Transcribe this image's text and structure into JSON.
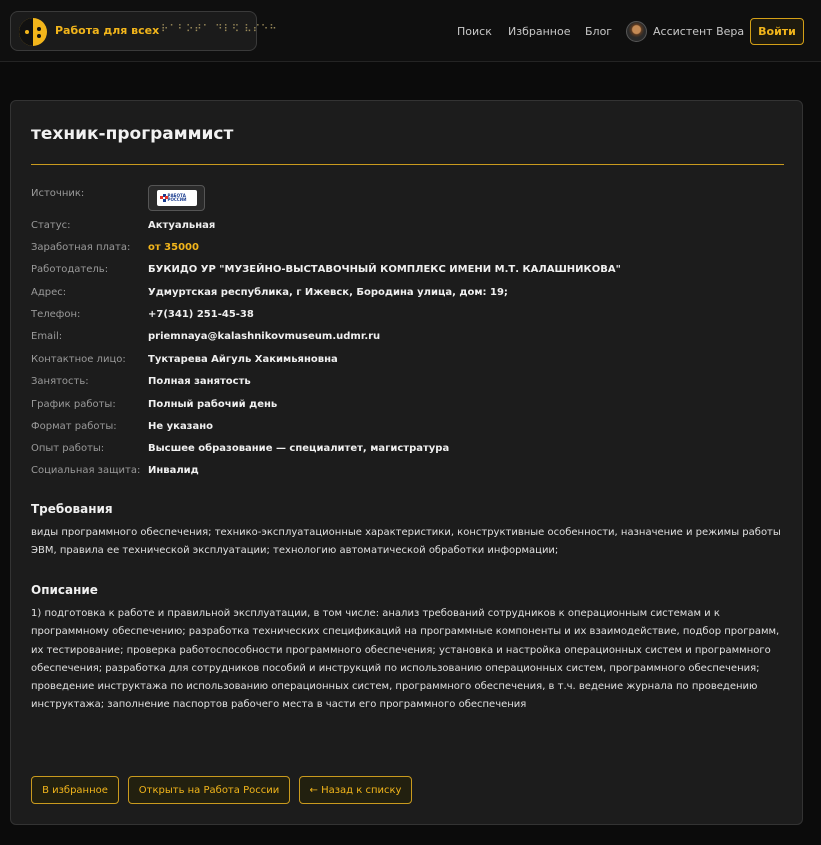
{
  "header": {
    "logo_title": "Работа для всех",
    "logo_braille": "⠗⠁⠃⠕⠞⠁ ⠙⠇⠫ ⠧⠎⠑⠓",
    "nav": {
      "search": "Поиск",
      "favorites": "Избранное",
      "blog": "Блог"
    },
    "assistant_label": "Ассистент Вера",
    "login_label": "Войти"
  },
  "job": {
    "title": "техник-программист",
    "fields": {
      "source_label": "Источник:",
      "source_logo_text": "РАБОТА РОССИИ",
      "status_label": "Статус:",
      "status": "Актуальная",
      "salary_label": "Заработная плата:",
      "salary": "от 35000",
      "employer_label": "Работодатель:",
      "employer": "БУКИДО УР \"МУЗЕЙНО-ВЫСТАВОЧНЫЙ КОМПЛЕКС ИМЕНИ М.Т. КАЛАШНИКОВА\"",
      "address_label": "Адрес:",
      "address": "Удмуртская республика, г Ижевск, Бородина улица, дом: 19;",
      "phone_label": "Телефон:",
      "phone": "+7(341) 251-45-38",
      "email_label": "Email:",
      "email": "priemnaya@kalashnikovmuseum.udmr.ru",
      "contact_label": "Контактное лицо:",
      "contact": "Туктарева Айгуль Хакимьяновна",
      "employment_label": "Занятость:",
      "employment": "Полная занятость",
      "schedule_label": "График работы:",
      "schedule": "Полный рабочий день",
      "format_label": "Формат работы:",
      "format": "Не указано",
      "experience_label": "Опыт работы:",
      "experience": "Высшее образование — специалитет, магистратура",
      "social_label": "Социальная защита:",
      "social": "Инвалид"
    },
    "requirements_title": "Требования",
    "requirements": "виды программного обеспечения; технико-эксплуатационные характеристики, конструктивные особенности, назначение и режимы работы ЭВМ, правила ее технической эксплуатации; технологию автоматической обработки информации;",
    "description_title": "Описание",
    "description": "1) подготовка к работе и правильной эксплуатации, в том числе: анализ требований сотрудников к операционным системам и к программному обеспечению; разработка технических спецификаций на программные компоненты и их взаимодействие, подбор программ, их тестирование; проверка работоспособности программного обеспечения; установка и настройка операционных систем и программного обеспечения; разработка для сотрудников пособий и инструкций по использованию операционных систем, программного обеспечения; проведение инструктажа по использованию операционных систем, программного обеспечения, в т.ч. ведение журнала по проведению инструктажа; заполнение паспортов рабочего места в части его программного обеспечения"
  },
  "actions": {
    "favorite": "В избранное",
    "open_source": "Открыть на Работа России",
    "back": "← Назад к списку"
  },
  "colors": {
    "accent": "#f2b51b",
    "background": "#0b0b0b",
    "card": "#1c1c1c"
  }
}
